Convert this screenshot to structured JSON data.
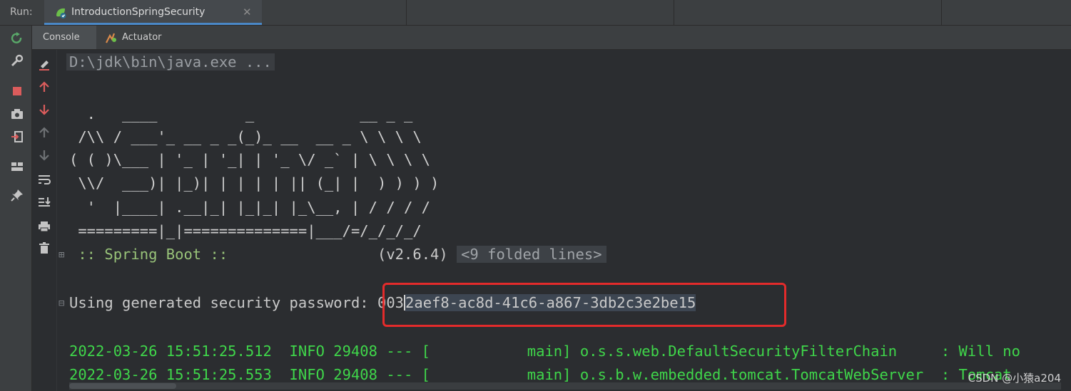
{
  "run_bar": {
    "label": "Run:",
    "tab_title": "IntroductionSpringSecurity",
    "tab_close": "✕"
  },
  "sub_tabs": [
    {
      "label": "Console",
      "active": true
    },
    {
      "label": "Actuator",
      "active": false
    }
  ],
  "left_toolbar": [
    "rerun-icon",
    "wrench-icon",
    "stop-icon",
    "camera-icon",
    "exit-icon",
    "layout-icon",
    "pin-icon"
  ],
  "side_toolbar": [
    "clear-icon",
    "up-red-icon",
    "down-red-icon",
    "up-icon",
    "down-icon",
    "soft-wrap-icon",
    "scroll-to-end-icon",
    "print-icon",
    "trash-icon"
  ],
  "console": {
    "command": "D:\\jdk\\bin\\java.exe ...",
    "banner": [
      "  .   ____          _            __ _ _",
      " /\\\\ / ___'_ __ _ _(_)_ __  __ _ \\ \\ \\ \\",
      "( ( )\\___ | '_ | '_| | '_ \\/ _` | \\ \\ \\ \\",
      " \\\\/  ___)| |_)| | | | | || (_| |  ) ) ) )",
      "  '  |____| .__|_| |_|_| |_\\__, | / / / /",
      " =========|_|==============|___/=/_/_/_/"
    ],
    "spring_label": " :: Spring Boot :: ",
    "spring_version": "(v2.6.4)",
    "folded": "<9 folded lines>",
    "password_label": "Using generated security password: ",
    "password_plain": "003",
    "password_selected": "2aef8-ac8d-41c6-a867-3db2c3e2be15",
    "logs": [
      "2022-03-26 15:51:25.512  INFO 29408 --- [           main] o.s.s.web.DefaultSecurityFilterChain     : Will no",
      "2022-03-26 15:51:25.553  INFO 29408 --- [           main] o.s.b.w.embedded.tomcat.TomcatWebServer  : Tomcat"
    ]
  },
  "watermark": "CSDN @小猿a204",
  "colors": {
    "log_green": "#3fd64a",
    "spring_green": "#98c379",
    "highlight_red": "#e32b2b",
    "tab_underline": "#4a88c7"
  }
}
